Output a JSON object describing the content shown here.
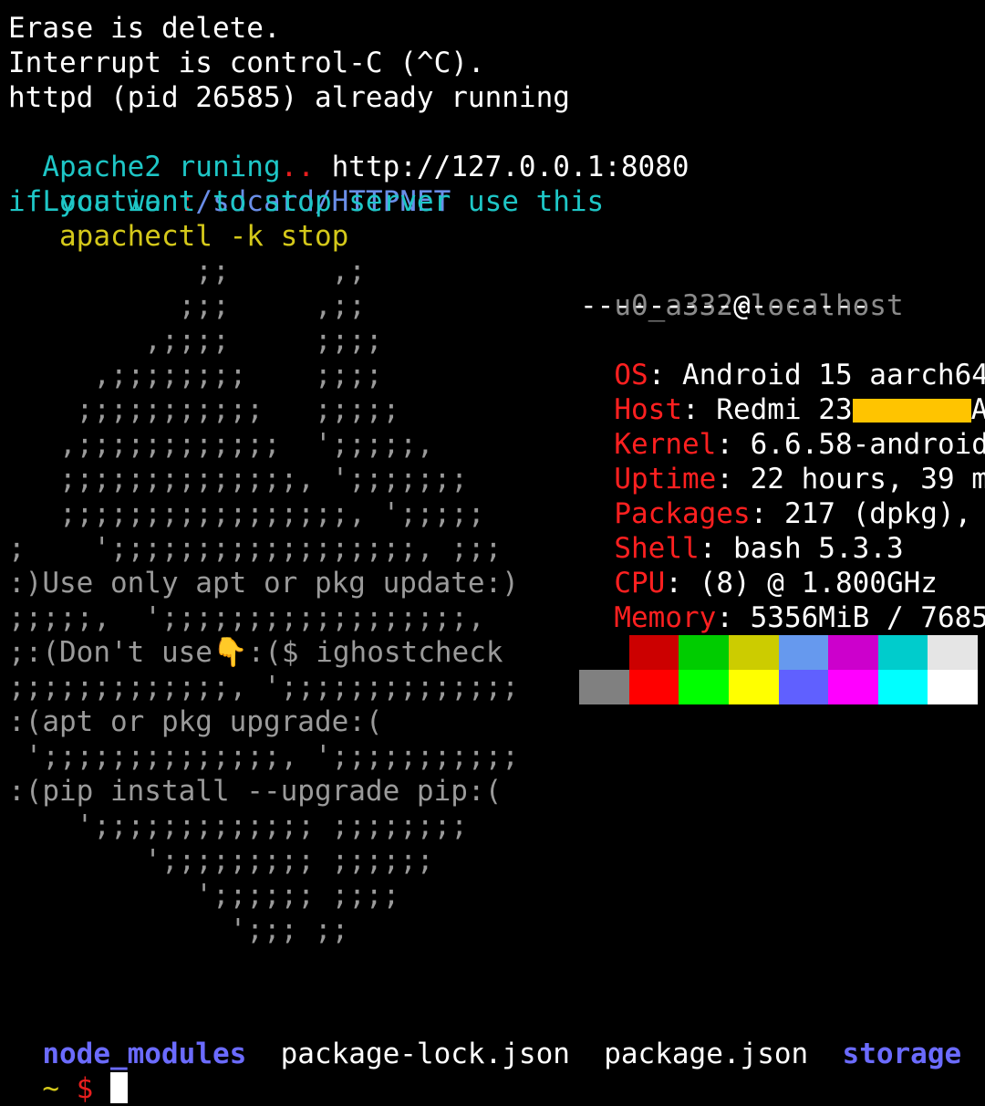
{
  "terminal": {
    "startup_lines": {
      "erase": "Erase is delete.",
      "interrupt": "Interrupt is control-C (^C).",
      "httpd": "httpd (pid 26585) already running",
      "apache_label": "Apache2 runing",
      "apache_dots": "..",
      "apache_url": " http://127.0.0.1:8080",
      "location_label": "Location",
      "location_sep": ":",
      "location_path": "/sdcard/HTTPNET",
      "stop_hint": "if you want to stop server use this",
      "stop_command": "   apachectl -k stop"
    },
    "ascii_art": [
      "           ;;      ,;",
      "          ;;;     ,;;",
      "        ,;;;;     ;;;;",
      "     ,;;;;;;;;    ;;;;",
      "    ;;;;;;;;;;;   ;;;;;",
      "   ,;;;;;;;;;;;;  ';;;;;,",
      "   ;;;;;;;;;;;;;;, ';;;;;;;",
      "   ;;;;;;;;;;;;;;;;;, ';;;;;",
      ";    ';;;;;;;;;;;;;;;;;;, ;;;",
      ":)Use only apt or pkg update:)",
      ";;;;;,  ';;;;;;;;;;;;;;;;;;,",
      ";:(Don't use👇:($ ighostcheck",
      ";;;;;;;;;;;;;, ';;;;;;;;;;;;;;",
      ":(apt or pkg upgrade:(",
      " ';;;;;;;;;;;;;;, ';;;;;;;;;;;",
      ":(pip install --upgrade pip:(",
      "    ';;;;;;;;;;;;; ;;;;;;;;",
      "        ';;;;;;;;; ;;;;;;",
      "           ';;;;;; ;;;;",
      "             ';;; ;;"
    ],
    "sysinfo": {
      "user": "u0_a332",
      "at": "@",
      "host": "localhost",
      "separator": "-----------------",
      "rows": [
        {
          "key": "OS",
          "value": ": Android 15 aarch64"
        },
        {
          "key": "Host",
          "value_prefix": ": Redmi 23",
          "value_suffix": "A"
        },
        {
          "key": "Kernel",
          "value": ": 6.6.58-android"
        },
        {
          "key": "Uptime",
          "value": ": 22 hours, 39 m"
        },
        {
          "key": "Packages",
          "value": ": 217 (dpkg),"
        },
        {
          "key": "Shell",
          "value": ": bash 5.3.3"
        },
        {
          "key": "CPU",
          "value": ": (8) @ 1.800GHz"
        },
        {
          "key": "Memory",
          "value": ": 5356MiB / 7685"
        }
      ]
    },
    "palette": {
      "row1": [
        "#000000",
        "#cc0000",
        "#00cc00",
        "#cccc00",
        "#6699ee",
        "#cc00cc",
        "#00cccc",
        "#e5e5e5"
      ],
      "row2": [
        "#808080",
        "#ff0000",
        "#00ff00",
        "#ffff00",
        "#6060ff",
        "#ff00ff",
        "#00ffff",
        "#ffffff"
      ]
    },
    "ls_output": {
      "dir1": "node_modules",
      "file1": "package-lock.json",
      "file2": "package.json",
      "dir2": "storage"
    },
    "prompt": {
      "tilde": "~",
      "dollar": "$"
    }
  }
}
